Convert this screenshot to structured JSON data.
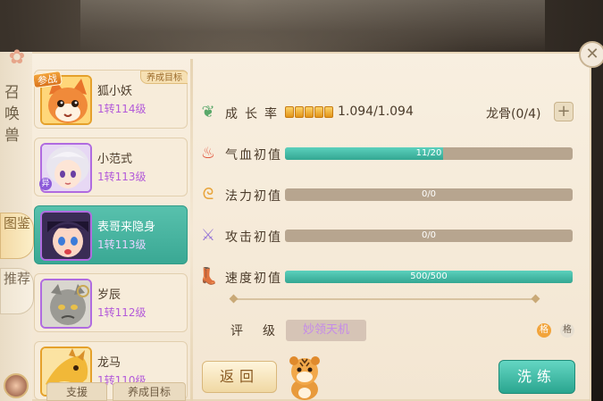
{
  "panel": {
    "close_icon": "close-icon",
    "title_vertical": "召唤兽"
  },
  "side_tabs": [
    {
      "label": "图鉴"
    },
    {
      "label": "推荐"
    }
  ],
  "pets": [
    {
      "name": "狐小妖",
      "level": "1转114级",
      "tag_battle": "参战",
      "tag_goal": "养成目标",
      "frame": "gold",
      "face": "fox"
    },
    {
      "name": "小范式",
      "level": "1转113级",
      "badge": "异",
      "frame": "purple",
      "face": "girl"
    },
    {
      "name": "表哥来隐身",
      "level": "1转113级",
      "frame": "purple",
      "face": "kid",
      "active": true
    },
    {
      "name": "岁辰",
      "level": "1转112级",
      "frame": "purple",
      "face": "stone"
    },
    {
      "name": "龙马",
      "level": "1转110级",
      "frame": "gold",
      "face": "dragon"
    }
  ],
  "bottom_tabs": [
    {
      "label": "支援"
    },
    {
      "label": "养成目标"
    }
  ],
  "stats": {
    "growth": {
      "label": "成长率",
      "value": "1.094/1.094",
      "dots": 5
    },
    "dragon_bone": {
      "label": "龙骨(0/4)"
    },
    "hp": {
      "label": "气血初值",
      "text": "11/20",
      "fill": 0.55
    },
    "mp": {
      "label": "法力初值",
      "text": "0/0",
      "fill": 0
    },
    "atk": {
      "label": "攻击初值",
      "text": "0/0",
      "fill": 0
    },
    "spd": {
      "label": "速度初值",
      "text": "500/500",
      "fill": 1.0
    }
  },
  "rating": {
    "label": "评级",
    "value": "妙领天机",
    "grade_a": "格",
    "grade_b": "格"
  },
  "buttons": {
    "back": "返回",
    "wash": "洗练"
  },
  "colors": {
    "accent_teal": "#3aa894",
    "gold": "#e39519"
  }
}
